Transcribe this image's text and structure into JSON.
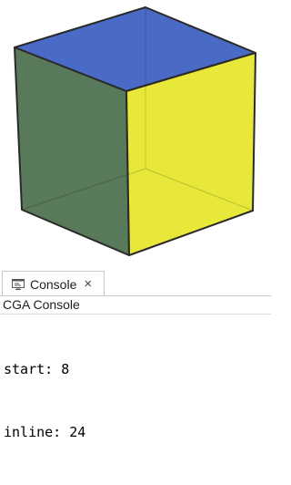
{
  "viewport": {
    "cube": {
      "top_face_color": "#3a5ec0",
      "left_face_color": "#4a6e4c",
      "right_face_color": "#e6e62a",
      "edge_color": "#2a2a2a"
    }
  },
  "console": {
    "tab": {
      "icon": "console-icon",
      "label": "Console",
      "close_glyph": "×"
    },
    "title": "CGA Console",
    "lines": [
      "start: 8",
      "inline: 24"
    ]
  }
}
